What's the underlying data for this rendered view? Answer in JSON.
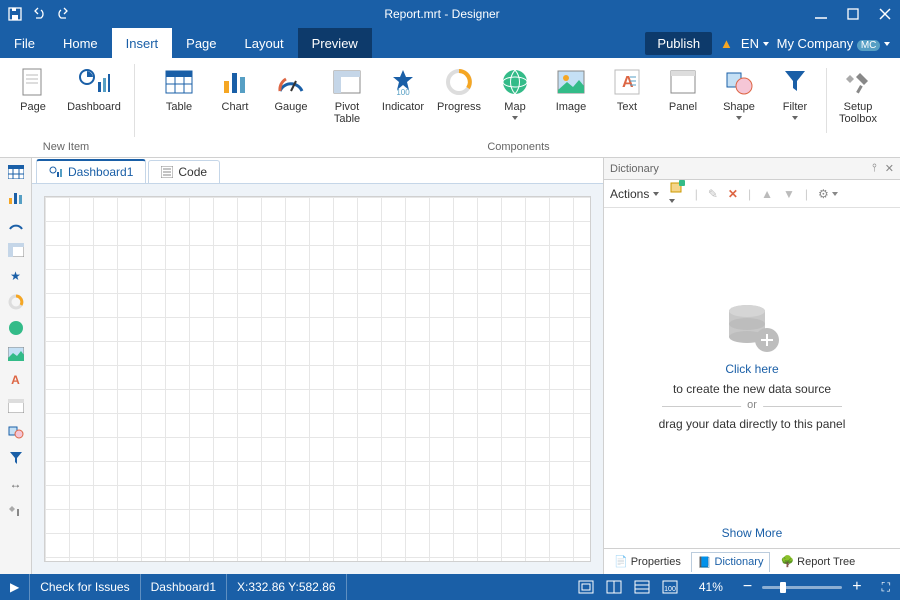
{
  "title": "Report.mrt - Designer",
  "menus": {
    "file": "File",
    "home": "Home",
    "insert": "Insert",
    "page": "Page",
    "layout": "Layout",
    "preview": "Preview"
  },
  "topRight": {
    "publish": "Publish",
    "lang": "EN",
    "company": "My Company",
    "badge": "MC"
  },
  "ribbonGroups": {
    "newItem": "New Item",
    "components": "Components"
  },
  "ribbon": {
    "page": "Page",
    "dashboard": "Dashboard",
    "table": "Table",
    "chart": "Chart",
    "gauge": "Gauge",
    "pivot": "Pivot\nTable",
    "indicator": "Indicator",
    "progress": "Progress",
    "map": "Map",
    "image": "Image",
    "text": "Text",
    "panel": "Panel",
    "shape": "Shape",
    "filter": "Filter",
    "toolbox": "Setup\nToolbox"
  },
  "docTabs": {
    "dashboard": "Dashboard1",
    "code": "Code"
  },
  "dictionary": {
    "title": "Dictionary",
    "actions": "Actions",
    "clickHere": "Click here",
    "line1": "to create the new data source",
    "or": "or",
    "line2": "drag your data directly to this panel",
    "showMore": "Show More"
  },
  "paneTabs": {
    "properties": "Properties",
    "dictionary": "Dictionary",
    "reportTree": "Report Tree"
  },
  "status": {
    "check": "Check for Issues",
    "doc": "Dashboard1",
    "coords": "X:332.86 Y:582.86",
    "zoom": "41%"
  }
}
